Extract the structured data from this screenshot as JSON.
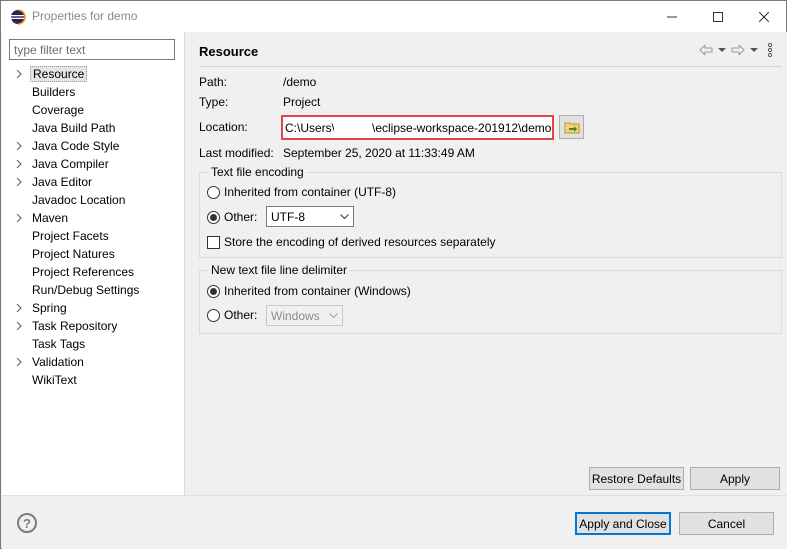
{
  "window": {
    "title": "Properties for demo",
    "icon": "eclipse-icon"
  },
  "filter": {
    "placeholder": "type filter text",
    "value": ""
  },
  "tree": {
    "items": [
      {
        "label": "Resource",
        "expandable": true,
        "selected": true
      },
      {
        "label": "Builders",
        "expandable": false
      },
      {
        "label": "Coverage",
        "expandable": false
      },
      {
        "label": "Java Build Path",
        "expandable": false
      },
      {
        "label": "Java Code Style",
        "expandable": true
      },
      {
        "label": "Java Compiler",
        "expandable": true
      },
      {
        "label": "Java Editor",
        "expandable": true
      },
      {
        "label": "Javadoc Location",
        "expandable": false
      },
      {
        "label": "Maven",
        "expandable": true
      },
      {
        "label": "Project Facets",
        "expandable": false
      },
      {
        "label": "Project Natures",
        "expandable": false
      },
      {
        "label": "Project References",
        "expandable": false
      },
      {
        "label": "Run/Debug Settings",
        "expandable": false
      },
      {
        "label": "Spring",
        "expandable": true
      },
      {
        "label": "Task Repository",
        "expandable": true
      },
      {
        "label": "Task Tags",
        "expandable": false
      },
      {
        "label": "Validation",
        "expandable": true
      },
      {
        "label": "WikiText",
        "expandable": false
      }
    ]
  },
  "page": {
    "title": "Resource",
    "path_label": "Path:",
    "path_value": "/demo",
    "type_label": "Type:",
    "type_value": "Project",
    "location_label": "Location:",
    "location_part1": "C:\\Users\\",
    "location_part2": "\\eclipse-workspace-201912\\demo",
    "modified_label": "Last modified:",
    "modified_value": "September 25, 2020 at 11:33:49 AM"
  },
  "encoding": {
    "legend": "Text file encoding",
    "inherited_label": "Inherited from container (UTF-8)",
    "other_label": "Other:",
    "other_value": "UTF-8",
    "derived_label": "Store the encoding of derived resources separately",
    "selected": "other"
  },
  "delimiter": {
    "legend": "New text file line delimiter",
    "inherited_label": "Inherited from container (Windows)",
    "other_label": "Other:",
    "other_value": "Windows",
    "selected": "inherited"
  },
  "buttons": {
    "restore_defaults": "Restore Defaults",
    "apply": "Apply",
    "apply_and_close": "Apply and Close",
    "cancel": "Cancel",
    "help": "?"
  },
  "colors": {
    "highlight_border": "#e04646",
    "default_button_border": "#0078d7"
  }
}
